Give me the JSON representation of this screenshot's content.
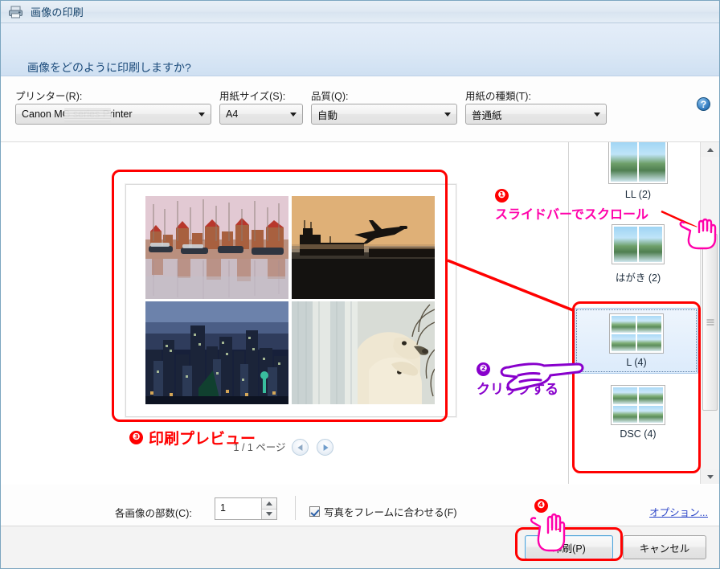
{
  "window": {
    "title": "画像の印刷",
    "icon": "printer-icon"
  },
  "header": {
    "instruction": "画像をどのように印刷しますか?",
    "help_icon": "help-icon",
    "help_glyph": "?"
  },
  "options_row": {
    "fields": [
      {
        "label": "プリンター(R):",
        "value": "Canon MG      series Printer",
        "name": "printer"
      },
      {
        "label": "用紙サイズ(S):",
        "value": "A4",
        "name": "paper-size"
      },
      {
        "label": "品質(Q):",
        "value": "自動",
        "name": "quality"
      },
      {
        "label": "用紙の種類(T):",
        "value": "普通紙",
        "name": "paper-type"
      }
    ]
  },
  "preview": {
    "page_text": "1 / 1 ページ",
    "prev_label": "前のページ",
    "next_label": "次のページ",
    "photos": [
      {
        "name": "photo-harbour",
        "alt": "夕暮れの港とヨット"
      },
      {
        "name": "photo-airplane",
        "alt": "夕焼け空を飛ぶ飛行機"
      },
      {
        "name": "photo-cityscape",
        "alt": "夕暮れの都市の風景"
      },
      {
        "name": "photo-polarbear",
        "alt": "滝の前のホッキョクグマ"
      }
    ]
  },
  "layouts": {
    "items": [
      {
        "label": "LL (2)",
        "cells": 2,
        "selected": false
      },
      {
        "label": "はがき (2)",
        "cells": 2,
        "selected": false
      },
      {
        "label": "L (4)",
        "cells": 4,
        "selected": true
      },
      {
        "label": "DSC (4)",
        "cells": 4,
        "selected": false
      }
    ],
    "scrollbar": {
      "up_arrow": "scroll-up-icon",
      "down_arrow": "scroll-down-icon"
    }
  },
  "bottom": {
    "copies_label": "各画像の部数(C):",
    "copies_value": "1",
    "fit_frame_label": "写真をフレームに合わせる(F)",
    "fit_frame_checked": true,
    "options_link": "オプション..."
  },
  "buttons": {
    "print": "印刷(P)",
    "cancel": "キャンセル"
  },
  "annotations": {
    "colors": {
      "red": "#ff0000",
      "magenta": "#ff00aa",
      "purple": "#8800cc"
    },
    "items": [
      {
        "number": "❶",
        "text": "スライドバーでスクロール",
        "color": "#ff00aa",
        "name": "annotation-scrollbar"
      },
      {
        "number": "❷",
        "text": "クリックする",
        "color": "#8800cc",
        "name": "annotation-click"
      },
      {
        "number": "❸",
        "text": "印刷プレビュー",
        "color": "#ff0000",
        "name": "annotation-preview"
      },
      {
        "number": "❹",
        "text": "",
        "color": "#ff00aa",
        "name": "annotation-print-button"
      }
    ]
  }
}
